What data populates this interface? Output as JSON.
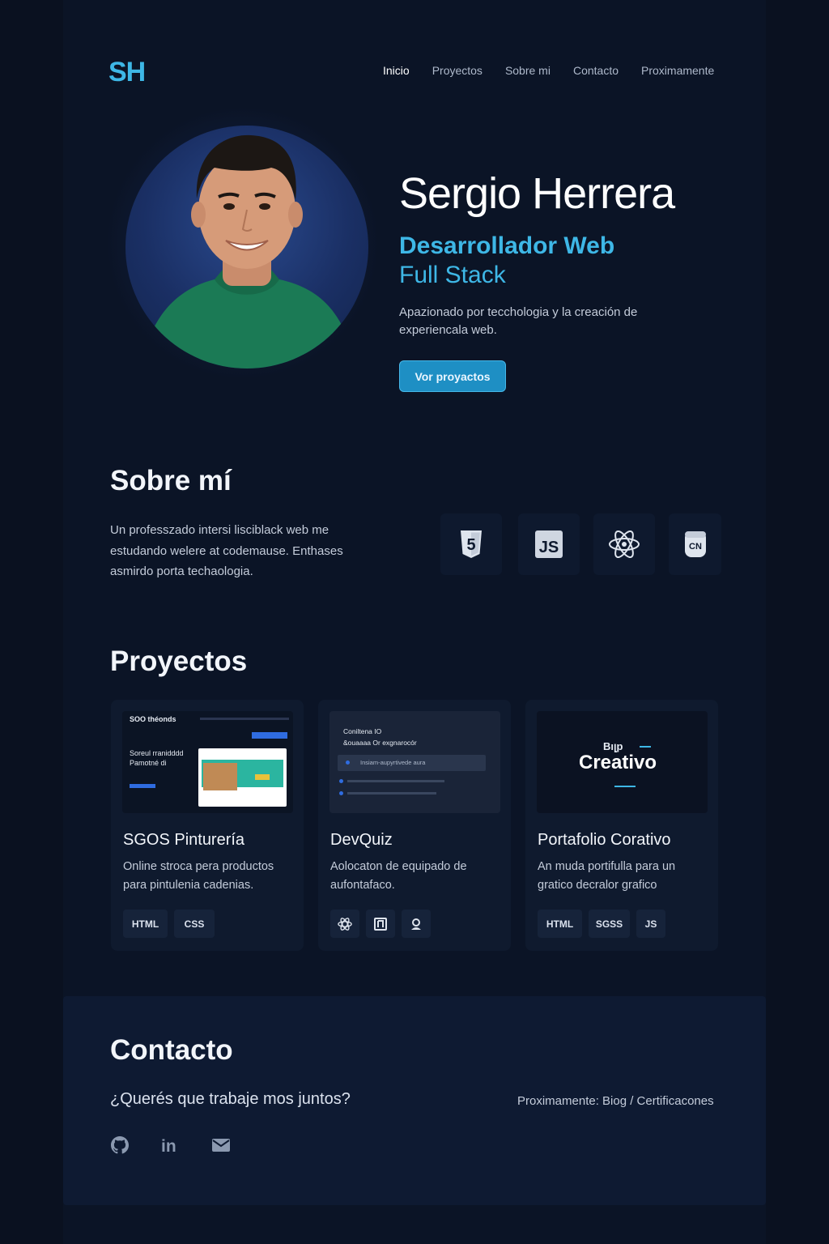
{
  "logo": "SH",
  "nav": {
    "items": [
      "Inicio",
      "Proyectos",
      "Sobre mi",
      "Contacto",
      "Proximamente"
    ],
    "active": "Inicio"
  },
  "hero": {
    "name": "Sergio Herrera",
    "role_line1": "Desarrollador Web",
    "role_line2": "Full Stack",
    "description": "Apazionado por tecchologia y la creación de experiencala web.",
    "button": "Vor proyactos"
  },
  "about": {
    "title": "Sobre mí",
    "text": "Un professzado intersi lisciblack web me estudando welere at codemause. Enthases asmirdo porta techaologia.",
    "tech_icons": [
      "html5-icon",
      "js-icon",
      "react-icon",
      "cn-icon"
    ],
    "tech_labels": [
      "5",
      "JS",
      "CN"
    ]
  },
  "projects": {
    "title": "Proyectos",
    "cards": [
      {
        "thumb_lines": [
          "SOO théonds",
          "Soreul rranidddd",
          "Pamotné di"
        ],
        "title": "SGOS Pinturería",
        "desc": "Online stroca pera productos para pintulenia cadenias.",
        "tags": [
          "HTML",
          "CSS"
        ]
      },
      {
        "thumb_lines": [
          "Coniltena IO",
          "&ouaaaa Or exgnarocór",
          "Insiam-aupyrtivede aura"
        ],
        "title": "DevQuiz",
        "desc": "Aolocaton de equipado de aufontafaco.",
        "tags": [
          "react-icon",
          "square-icon",
          "user-icon"
        ]
      },
      {
        "thumb_lines": [
          "Bıլp",
          "Creativo"
        ],
        "title": "Portafolio Corativo",
        "desc": "An muda portifulla para un gratico decralor grafico",
        "tags": [
          "HTML",
          "SGSS",
          "JS"
        ]
      }
    ]
  },
  "contact": {
    "title": "Contacto",
    "question": "¿Querés que trabaje mos juntos?",
    "soon": "Proximamente: Biog / Certificacones",
    "social": [
      "github-icon",
      "linkedin-icon",
      "mail-icon"
    ],
    "linkedin_text": "in"
  },
  "colors": {
    "accent": "#3eb7e6",
    "button": "#1e8fc4",
    "background": "#0a1120",
    "card": "#0f1a2e"
  }
}
